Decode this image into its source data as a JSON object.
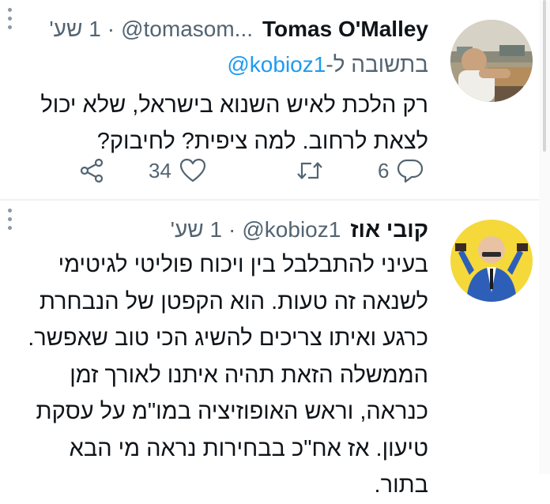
{
  "tweets": [
    {
      "display_name": "Tomas O'Malley",
      "handle": "@tomasom...",
      "separator": "·",
      "time": "1 שע'",
      "reply_prefix": "בתשובה ל-",
      "reply_handle": "@kobioz1",
      "text_lines": [
        "רק הלכת לאיש השנוא בישראל, שלא יכול",
        "לצאת לרחוב. למה ציפית? לחיבוק?"
      ],
      "counts": {
        "like": "34",
        "reply": "6"
      }
    },
    {
      "display_name": "קובי אוז",
      "handle": "@kobioz1",
      "separator": "·",
      "time": "1 שע'",
      "text_lines": [
        "בעיני להתבלבל בין ויכוח פוליטי לגיטימי",
        "לשנאה זה טעות. הוא הקפטן של הנבחרת",
        "כרגע ואיתו צריכים להשיג הכי טוב שאפשר.",
        "הממשלה הזאת תהיה איתנו לאורך זמן",
        "כנראה, וראש האופוזיציה במו\"מ על עסקת",
        "טיעון. אז אח\"כ בבחירות נראה מי הבא",
        "בתור."
      ]
    }
  ],
  "icons": [
    "more-icon",
    "share-icon",
    "heart-icon",
    "retweet-icon",
    "reply-icon"
  ],
  "colors": {
    "link": "#1d9bf0",
    "secondary_text": "#536471",
    "primary_text": "#0f1419",
    "avatar2_bg": "#f5d83a"
  }
}
